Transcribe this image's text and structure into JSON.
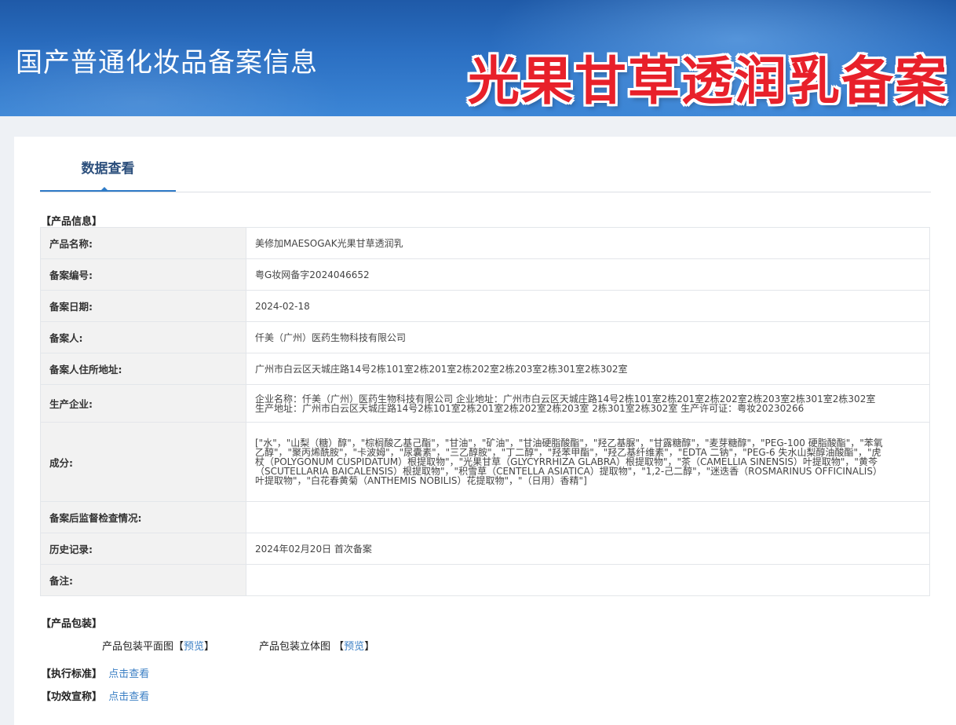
{
  "header": {
    "site_title": "国产普通化妆品备案信息",
    "banner": "光果甘草透润乳备案",
    "colors": {
      "header_blue": "#2b6fc2",
      "banner_red": "#e8202a",
      "link_blue": "#3b7fc4"
    }
  },
  "tabs": [
    {
      "label": "数据查看",
      "active": true
    }
  ],
  "product_info": {
    "section_title": "【产品信息】",
    "rows": [
      {
        "label": "产品名称:",
        "value": "美修加MAESOGAK光果甘草透润乳"
      },
      {
        "label": "备案编号:",
        "value": "粤G妆网备字2024046652"
      },
      {
        "label": "备案日期:",
        "value": "2024-02-18"
      },
      {
        "label": "备案人:",
        "value": "仟美（广州）医药生物科技有限公司"
      },
      {
        "label": "备案人住所地址:",
        "value": "广州市白云区天城庄路14号2栋101室2栋201室2栋202室2栋203室2栋301室2栋302室"
      },
      {
        "label": "生产企业:",
        "value": "企业名称：仟美（广州）医药生物科技有限公司 企业地址：广州市白云区天城庄路14号2栋101室2栋201室2栋202室2栋203室2栋301室2栋302室 生产地址：广州市白云区天城庄路14号2栋101室2栋201室2栋202室2栋203室 2栋301室2栋302室 生产许可证：粤妆20230266"
      },
      {
        "label": "成分:",
        "value": "[\"水\"，\"山梨（糖）醇\"，\"棕榈酸乙基己酯\"，\"甘油\"，\"矿油\"，\"甘油硬脂酸酯\"，\"羟乙基脲\"，\"甘露糖醇\"，\"麦芽糖醇\"，\"PEG-100 硬脂酸酯\"，\"苯氧乙醇\"，\"聚丙烯酰胺\"，\"卡波姆\"，\"尿囊素\"，\"三乙醇胺\"，\"丁二醇\"，\"羟苯甲酯\"，\"羟乙基纤维素\"，\"EDTA 二钠\"，\"PEG-6 失水山梨醇油酸酯\"，\"虎杖（POLYGONUM CUSPIDATUM）根提取物\"，\"光果甘草（GLYCYRRHIZA GLABRA）根提取物\"，\"茶（CAMELLIA SINENSIS）叶提取物\"，\"黄芩（SCUTELLARIA BAICALENSIS）根提取物\"，\"积雪草（CENTELLA ASIATICA）提取物\"，\"1,2-己二醇\"，\"迷迭香（ROSMARINUS OFFICINALIS）叶提取物\"，\"白花春黄菊（ANTHEMIS NOBILIS）花提取物\"，\"（日用）香精\"]"
      },
      {
        "label": "备案后监督检查情况:",
        "value": ""
      },
      {
        "label": "历史记录:",
        "value": "2024年02月20日 首次备案"
      },
      {
        "label": "备注:",
        "value": ""
      }
    ]
  },
  "packaging": {
    "section_title": "【产品包装】",
    "flat_label": "产品包装平面图",
    "flat_link": "预览",
    "solid_label": "产品包装立体图",
    "solid_link": "预览",
    "bracket_open": "【",
    "bracket_close": "】"
  },
  "standard": {
    "label": "【执行标准】",
    "link": "点击查看"
  },
  "efficacy": {
    "label": "【功效宣称】",
    "link": "点击查看"
  }
}
